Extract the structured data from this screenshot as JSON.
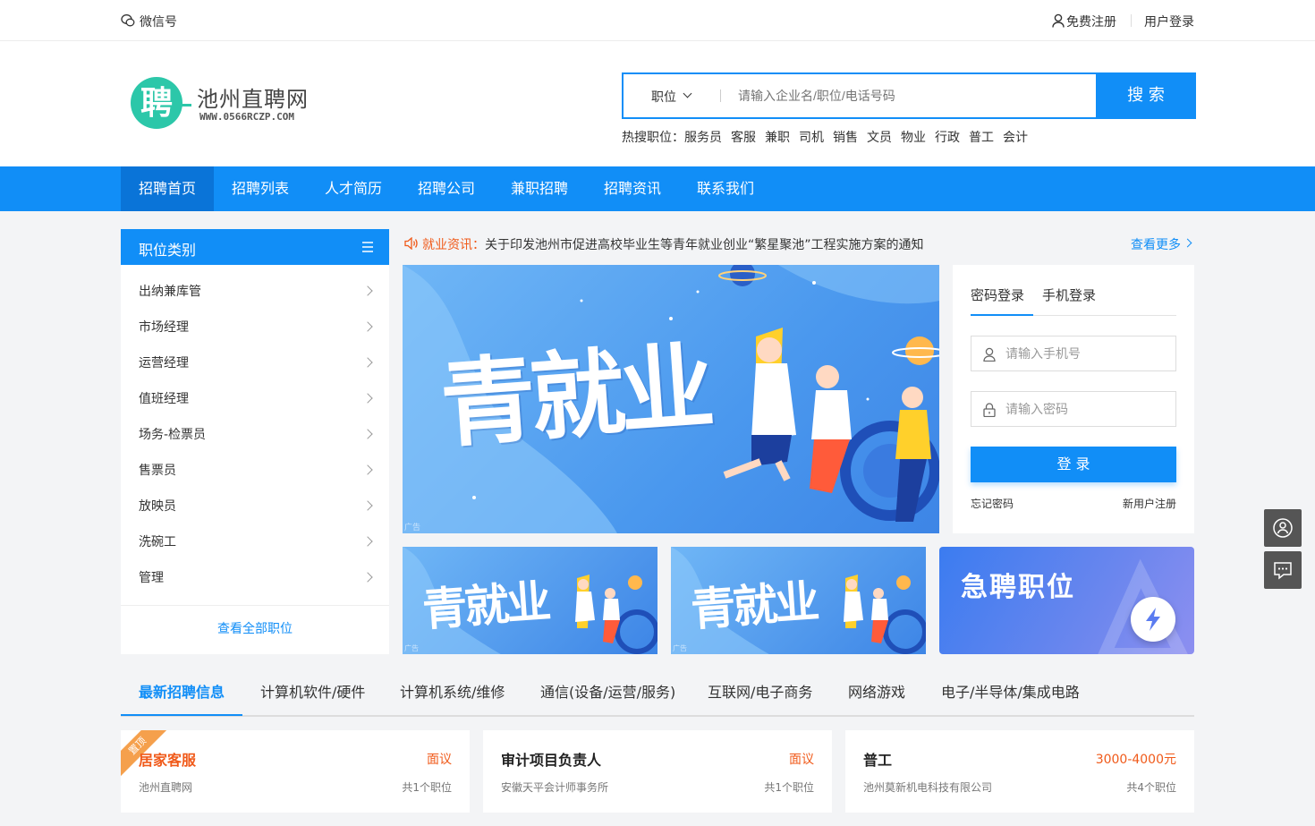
{
  "topbar": {
    "wechat": "微信号",
    "register": "免费注册",
    "login": "用户登录"
  },
  "logo": {
    "mark": "聘",
    "name": "池州直聘网",
    "domain": "WWW.0566RCZP.COM"
  },
  "search": {
    "type": "职位",
    "placeholder": "请输入企业名/职位/电话号码",
    "button": "搜 索"
  },
  "hot": {
    "label": "热搜职位：",
    "words": [
      "服务员",
      "客服",
      "兼职",
      "司机",
      "销售",
      "文员",
      "物业",
      "行政",
      "普工",
      "会计"
    ]
  },
  "nav": [
    "招聘首页",
    "招聘列表",
    "人才简历",
    "招聘公司",
    "兼职招聘",
    "招聘资讯",
    "联系我们"
  ],
  "category": {
    "title": "职位类别",
    "items": [
      "出纳兼库管",
      "市场经理",
      "运营经理",
      "值班经理",
      "场务-检票员",
      "售票员",
      "放映员",
      "洗碗工",
      "管理"
    ],
    "view_all": "查看全部职位"
  },
  "news": {
    "label": "就业资讯：",
    "text": "关于印发池州市促进高校毕业生等青年就业创业“繁星聚池”工程实施方案的通知",
    "more": "查看更多"
  },
  "banner": {
    "title": "青就业",
    "ad": "广告"
  },
  "login_box": {
    "tabs": [
      "密码登录",
      "手机登录"
    ],
    "phone_placeholder": "请输入手机号",
    "password_placeholder": "请输入密码",
    "button": "登 录",
    "forgot": "忘记密码",
    "new_user": "新用户注册"
  },
  "urgent": {
    "title": "急聘职位"
  },
  "job_tabs": [
    "最新招聘信息",
    "计算机软件/硬件",
    "计算机系统/维修",
    "通信(设备/运营/服务)",
    "互联网/电子商务",
    "网络游戏",
    "电子/半导体/集成电路"
  ],
  "jobs": [
    {
      "title": "居家客服",
      "salary": "面议",
      "company": "池州直聘网",
      "count": "共1个职位",
      "badge": "置顶"
    },
    {
      "title": "审计项目负责人",
      "salary": "面议",
      "company": "安徽天平会计师事务所",
      "count": "共1个职位"
    },
    {
      "title": "普工",
      "salary": "3000-4000元",
      "company": "池州莫新机电科技有限公司",
      "count": "共4个职位"
    }
  ],
  "colors": {
    "primary": "#118ef7",
    "salary": "#f05a1a",
    "news": "#f05a1a"
  }
}
